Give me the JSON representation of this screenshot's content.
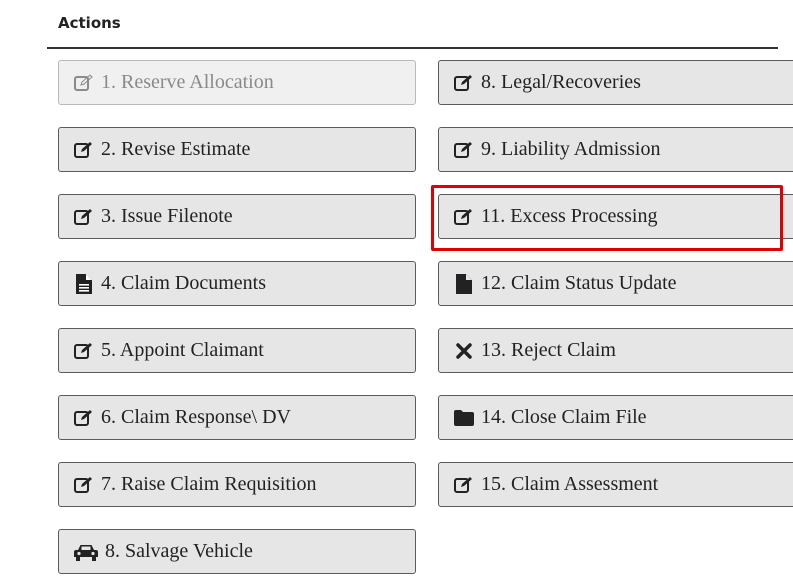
{
  "section": {
    "title": "Actions"
  },
  "buttons": [
    {
      "label": "1. Reserve Allocation",
      "icon": "edit-icon",
      "disabled": true
    },
    {
      "label": "2. Revise Estimate",
      "icon": "edit-icon"
    },
    {
      "label": "3. Issue Filenote",
      "icon": "edit-icon"
    },
    {
      "label": "4. Claim Documents",
      "icon": "document-icon"
    },
    {
      "label": "5. Appoint Claimant",
      "icon": "edit-icon"
    },
    {
      "label": "6. Claim Response\\ DV",
      "icon": "edit-icon"
    },
    {
      "label": "7. Raise Claim Requisition",
      "icon": "edit-icon"
    },
    {
      "label": "8. Salvage Vehicle",
      "icon": "car-icon"
    },
    {
      "label": "8. Legal/Recoveries",
      "icon": "edit-icon"
    },
    {
      "label": "9. Liability Admission",
      "icon": "edit-icon"
    },
    {
      "label": "11. Excess Processing",
      "icon": "edit-icon",
      "highlighted": true
    },
    {
      "label": "12. Claim Status Update",
      "icon": "file-icon"
    },
    {
      "label": "13. Reject Claim",
      "icon": "close-icon"
    },
    {
      "label": "14. Close Claim File",
      "icon": "folder-icon"
    },
    {
      "label": "15. Claim Assessment",
      "icon": "edit-icon"
    }
  ],
  "colors": {
    "highlight": "#e00000",
    "button_bg": "#e6e6e6"
  }
}
